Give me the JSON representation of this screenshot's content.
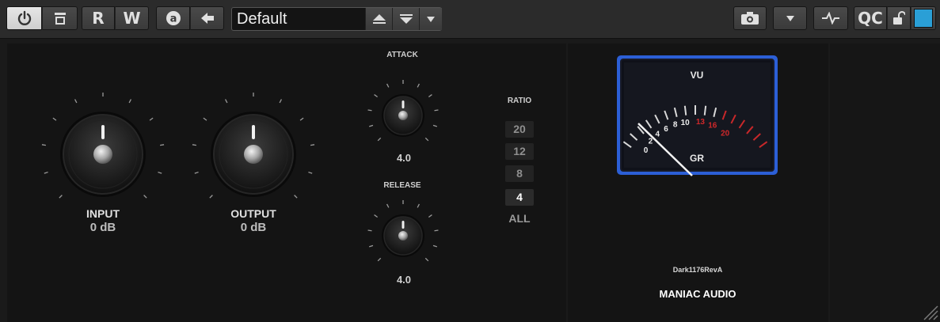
{
  "toolbar": {
    "power_icon": "power-icon",
    "preset_icon": "plugin-preset-icon",
    "read_label": "R",
    "write_label": "W",
    "auto_icon": "automation-a-icon",
    "back_icon": "arrow-left-icon",
    "preset_name": "Default",
    "preset_up_icon": "triangle-up-icon",
    "preset_down_icon": "triangle-down-bar-icon",
    "preset_menu_icon": "dropdown-triangle-icon",
    "camera_icon": "snapshot-camera-icon",
    "menu_dropdown_icon": "dropdown-triangle-icon",
    "pulse_icon": "pulse-icon",
    "qc_label": "QC",
    "lock_icon": "unlock-icon",
    "color_swatch": "#2a9fd6"
  },
  "controls": {
    "input": {
      "label": "INPUT",
      "value": "0 dB"
    },
    "output": {
      "label": "OUTPUT",
      "value": "0 dB"
    },
    "attack": {
      "label": "ATTACK",
      "value": "4.0"
    },
    "release": {
      "label": "RELEASE",
      "value": "4.0"
    },
    "ratio": {
      "label": "RATIO",
      "options": [
        "20",
        "12",
        "8",
        "4"
      ],
      "selected": "4",
      "all_label": "ALL"
    }
  },
  "meter": {
    "title": "VU",
    "subtitle": "GR",
    "scale_white": [
      "0",
      "2",
      "4",
      "6",
      "8",
      "10"
    ],
    "scale_red": [
      "13",
      "16",
      "20"
    ],
    "frame_color": "#2c5fd6"
  },
  "branding": {
    "model": "Dark1176RevA",
    "maker": "MANIAC AUDIO"
  }
}
